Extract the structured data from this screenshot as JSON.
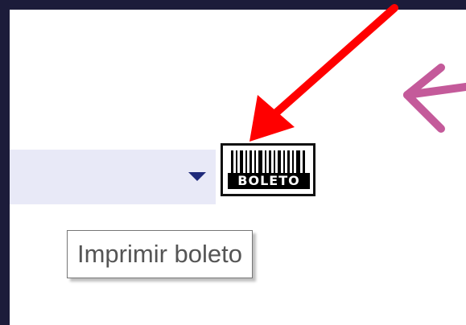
{
  "toolbar": {
    "dropdown_icon": "chevron-down-icon",
    "boleto_button": {
      "label": "BOLETO",
      "icon": "barcode-icon"
    }
  },
  "tooltip": {
    "text": "Imprimir boleto"
  },
  "annotations": {
    "red_arrow_color": "#ff0000",
    "pink_arrow_color": "#c45a9a"
  },
  "colors": {
    "frame_background": "#1c1c3a",
    "dropdown_background": "#e8e9f7",
    "dropdown_arrow": "#1f2a7a"
  }
}
